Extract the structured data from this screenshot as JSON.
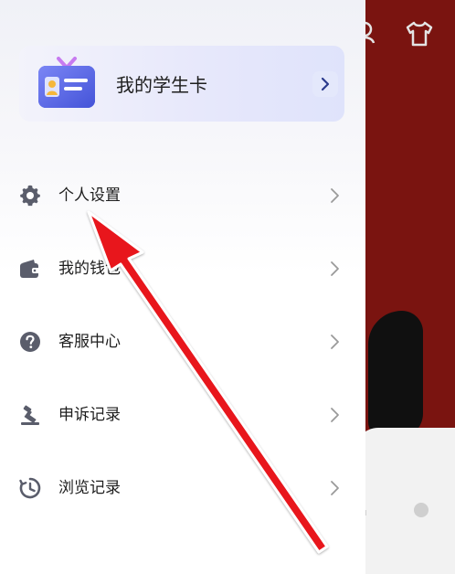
{
  "card": {
    "title": "我的学生卡"
  },
  "menu": {
    "items": [
      {
        "label": "个人设置",
        "icon": "gear-icon"
      },
      {
        "label": "我的钱包",
        "icon": "wallet-icon"
      },
      {
        "label": "客服中心",
        "icon": "help-icon"
      },
      {
        "label": "申诉记录",
        "icon": "gavel-icon"
      },
      {
        "label": "浏览记录",
        "icon": "history-icon"
      }
    ]
  },
  "colors": {
    "annotation_arrow": "#e8141c",
    "background": "#7a1410",
    "accent": "#5a6bf0"
  }
}
